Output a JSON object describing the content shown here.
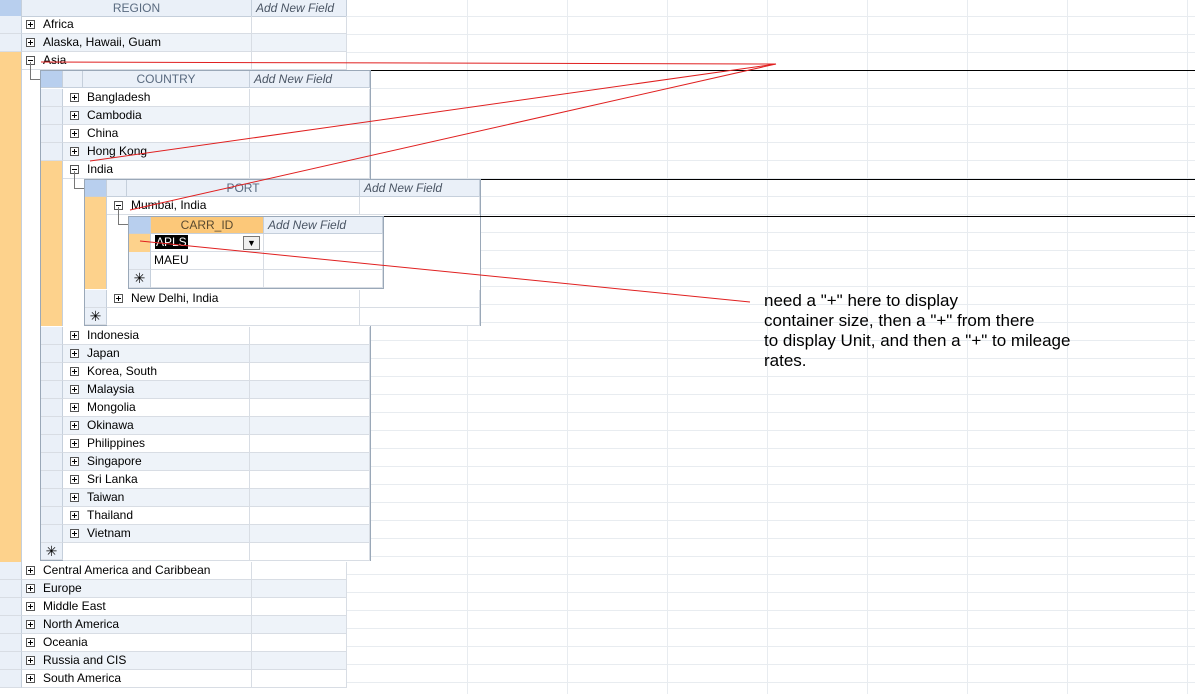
{
  "region_grid": {
    "header": "REGION",
    "add_new_field": "Add New Field",
    "rows_before": [
      "Africa",
      "Alaska, Hawaii, Guam"
    ],
    "expanded_row": "Asia",
    "rows_after": [
      "Central America and Caribbean",
      "Europe",
      "Middle East",
      "North America",
      "Oceania",
      "Russia and CIS",
      "South America"
    ]
  },
  "country_grid": {
    "header": "COUNTRY",
    "add_new_field": "Add New Field",
    "rows_before": [
      "Bangladesh",
      "Cambodia",
      "China",
      "Hong Kong"
    ],
    "expanded_row": "India",
    "rows_after": [
      "Indonesia",
      "Japan",
      "Korea, South",
      "Malaysia",
      "Mongolia",
      "Okinawa",
      "Philippines",
      "Singapore",
      "Sri Lanka",
      "Taiwan",
      "Thailand",
      "Vietnam"
    ]
  },
  "port_grid": {
    "header": "PORT",
    "add_new_field": "Add New Field",
    "expanded_row": "Mumbai, India",
    "rows_after": [
      "New Delhi, India"
    ]
  },
  "carr_grid": {
    "header": "CARR_ID",
    "add_new_field": "Add New Field",
    "rows": [
      "APLS",
      "MAEU"
    ],
    "dropdown_icon": "chevron-down-icon"
  },
  "new_record_symbol": "✳",
  "annotation": {
    "lines": [
      "need a \"+\" here to display",
      "container size, then a \"+\" from there",
      "to display Unit, and then a \"+\" to mileage",
      "rates."
    ],
    "color": "#e02020"
  },
  "colors": {
    "selected_row": "#fdd28c",
    "header": "#eaf0f8",
    "header_selected": "#b8cfee"
  }
}
